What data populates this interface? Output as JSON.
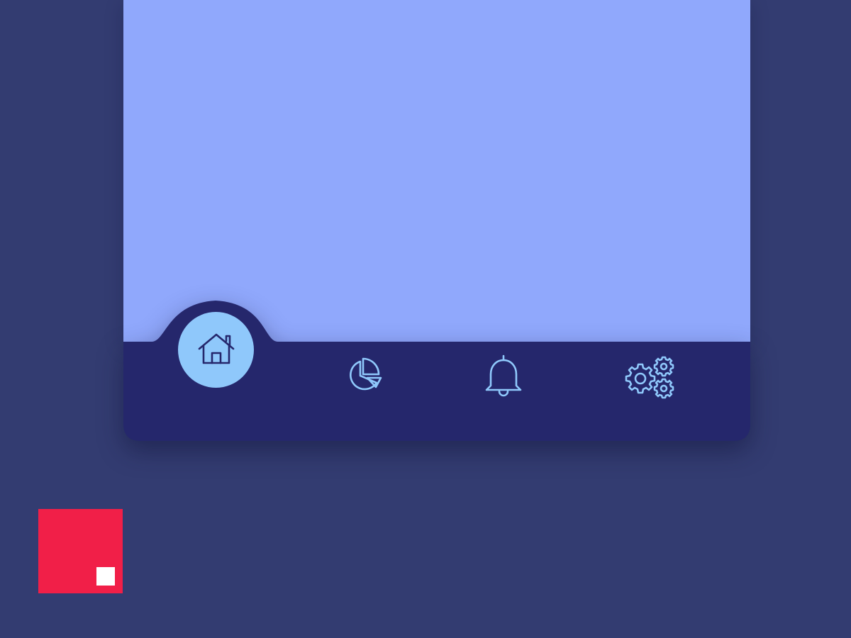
{
  "colors": {
    "background": "#333c71",
    "screen": "#90a8fc",
    "nav_bar": "#25276c",
    "active_bubble": "#8fc8fb",
    "icon_active": "#25276c",
    "icon_inactive": "#8fc8fb",
    "logo": "#f11f48"
  },
  "bottom_nav": {
    "active_index": 0,
    "items": [
      {
        "id": "home",
        "icon": "home-icon",
        "active": true
      },
      {
        "id": "stats",
        "icon": "pie-chart-icon",
        "active": false
      },
      {
        "id": "notifications",
        "icon": "bell-icon",
        "active": false
      },
      {
        "id": "settings",
        "icon": "gears-icon",
        "active": false
      }
    ]
  },
  "logo": {
    "icon": "brand-logo"
  }
}
